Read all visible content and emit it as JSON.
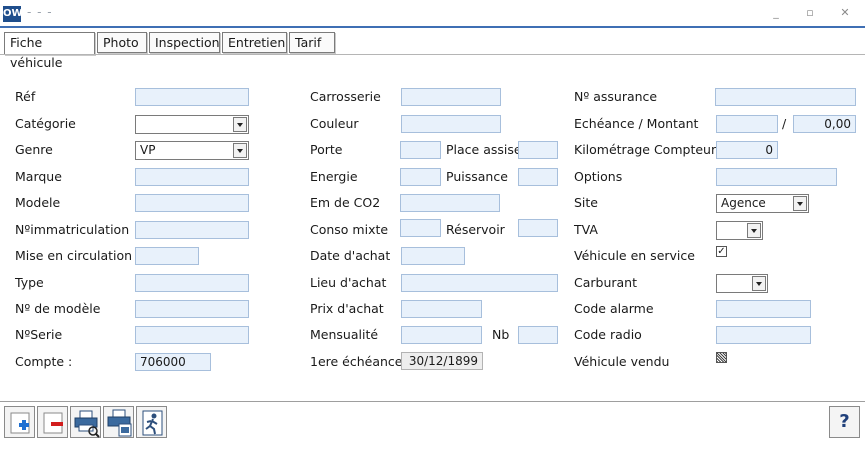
{
  "window": {
    "app_icon_text": "OW",
    "title": "- - -"
  },
  "tabs": [
    {
      "label": "Fiche véhicule",
      "active": true
    },
    {
      "label": "Photo"
    },
    {
      "label": "Inspection"
    },
    {
      "label": "Entretien"
    },
    {
      "label": "Tarif"
    }
  ],
  "col1": {
    "ref": "Réf",
    "categorie": "Catégorie",
    "genre": "Genre",
    "genre_value": "VP",
    "marque": "Marque",
    "modele": "Modele",
    "immat": "Nºimmatriculation",
    "mise_circ": "Mise en circulation",
    "type": "Type",
    "no_modele": "Nº de modèle",
    "no_serie": "NºSerie",
    "compte": "Compte :",
    "compte_value": "706000"
  },
  "col2": {
    "carrosserie": "Carrosserie",
    "couleur": "Couleur",
    "porte": "Porte",
    "place_assise": "Place assise",
    "energie": "Energie",
    "puissance": "Puissance",
    "em_co2": "Em de CO2",
    "conso_mixte": "Conso mixte",
    "reservoir": "Réservoir",
    "date_achat": "Date d'achat",
    "lieu_achat": "Lieu d'achat",
    "prix_achat": "Prix d'achat",
    "mensualite": "Mensualité",
    "nb": "Nb",
    "premiere_echeance": "1ere échéance",
    "premiere_echeance_value": "30/12/1899"
  },
  "col3": {
    "no_assurance": "Nº assurance",
    "echeance_montant": "Echéance / Montant",
    "slash": "/",
    "montant_value": "0,00",
    "km_compteur": "Kilométrage Compteur",
    "km_value": "0",
    "options": "Options",
    "site": "Site",
    "site_value": "Agence",
    "tva": "TVA",
    "vehicule_service": "Véhicule en service",
    "carburant": "Carburant",
    "code_alarme": "Code alarme",
    "code_radio": "Code radio",
    "vehicule_vendu": "Véhicule vendu"
  },
  "help_label": "?",
  "icons": [
    "add-icon",
    "delete-icon",
    "print-preview-icon",
    "print-icon",
    "exit-icon",
    "help-icon"
  ]
}
